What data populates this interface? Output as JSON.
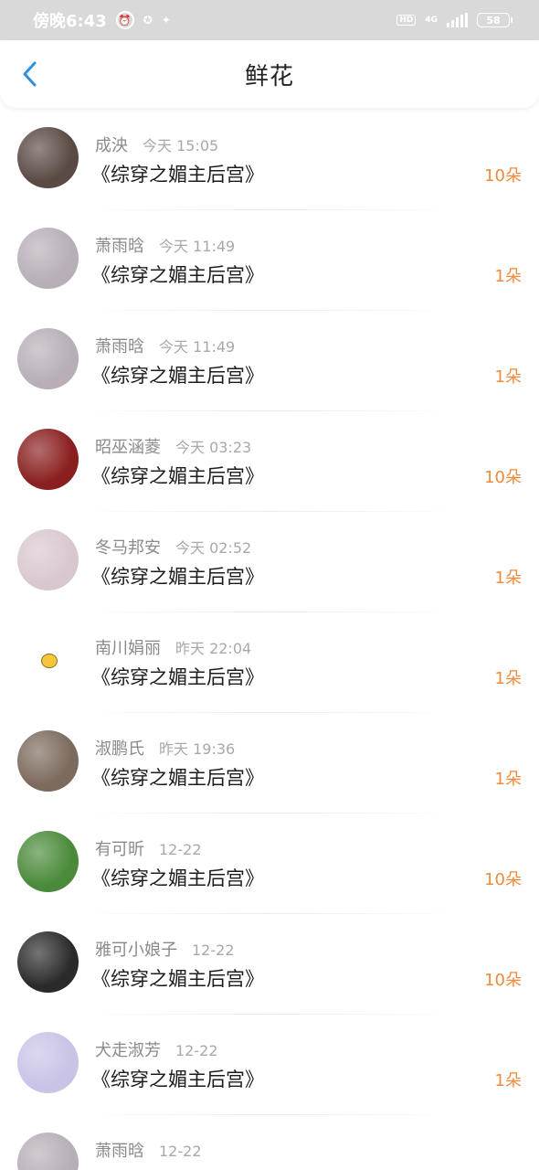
{
  "status_bar": {
    "time": "傍晚6:43",
    "network": "4G",
    "battery": "58"
  },
  "header": {
    "title": "鲜花"
  },
  "items": [
    {
      "name": "成泱",
      "time": "今天 15:05",
      "book": "《综穿之媚主后宫》",
      "count": "10朵",
      "avatar_color": "#5a4a44"
    },
    {
      "name": "萧雨晗",
      "time": "今天 11:49",
      "book": "《综穿之媚主后宫》",
      "count": "1朵",
      "avatar_color": "#b7aeb8"
    },
    {
      "name": "萧雨晗",
      "time": "今天 11:49",
      "book": "《综穿之媚主后宫》",
      "count": "1朵",
      "avatar_color": "#b7aeb8"
    },
    {
      "name": "昭巫涵菱",
      "time": "今天 03:23",
      "book": "《综穿之媚主后宫》",
      "count": "10朵",
      "avatar_color": "#8a1f1f"
    },
    {
      "name": "冬马邦安",
      "time": "今天 02:52",
      "book": "《综穿之媚主后宫》",
      "count": "1朵",
      "avatar_color": "#d9c7cf"
    },
    {
      "name": "南川娟丽",
      "time": "昨天 22:04",
      "book": "《综穿之媚主后宫》",
      "count": "1朵",
      "avatar_color": "#ffffff"
    },
    {
      "name": "淑鹏氏",
      "time": "昨天 19:36",
      "book": "《综穿之媚主后宫》",
      "count": "1朵",
      "avatar_color": "#7c6a5c"
    },
    {
      "name": "有可昕",
      "time": "12-22",
      "book": "《综穿之媚主后宫》",
      "count": "10朵",
      "avatar_color": "#4a8a3a"
    },
    {
      "name": "雅可小娘子",
      "time": "12-22",
      "book": "《综穿之媚主后宫》",
      "count": "10朵",
      "avatar_color": "#2a2a2a"
    },
    {
      "name": "犬走淑芳",
      "time": "12-22",
      "book": "《综穿之媚主后宫》",
      "count": "1朵",
      "avatar_color": "#c9c3e6"
    },
    {
      "name": "萧雨晗",
      "time": "12-22",
      "book": "",
      "count": "",
      "avatar_color": "#b7aeb8"
    }
  ],
  "colors": {
    "accent": "#f08a3c",
    "back_icon": "#2f8fe0"
  }
}
